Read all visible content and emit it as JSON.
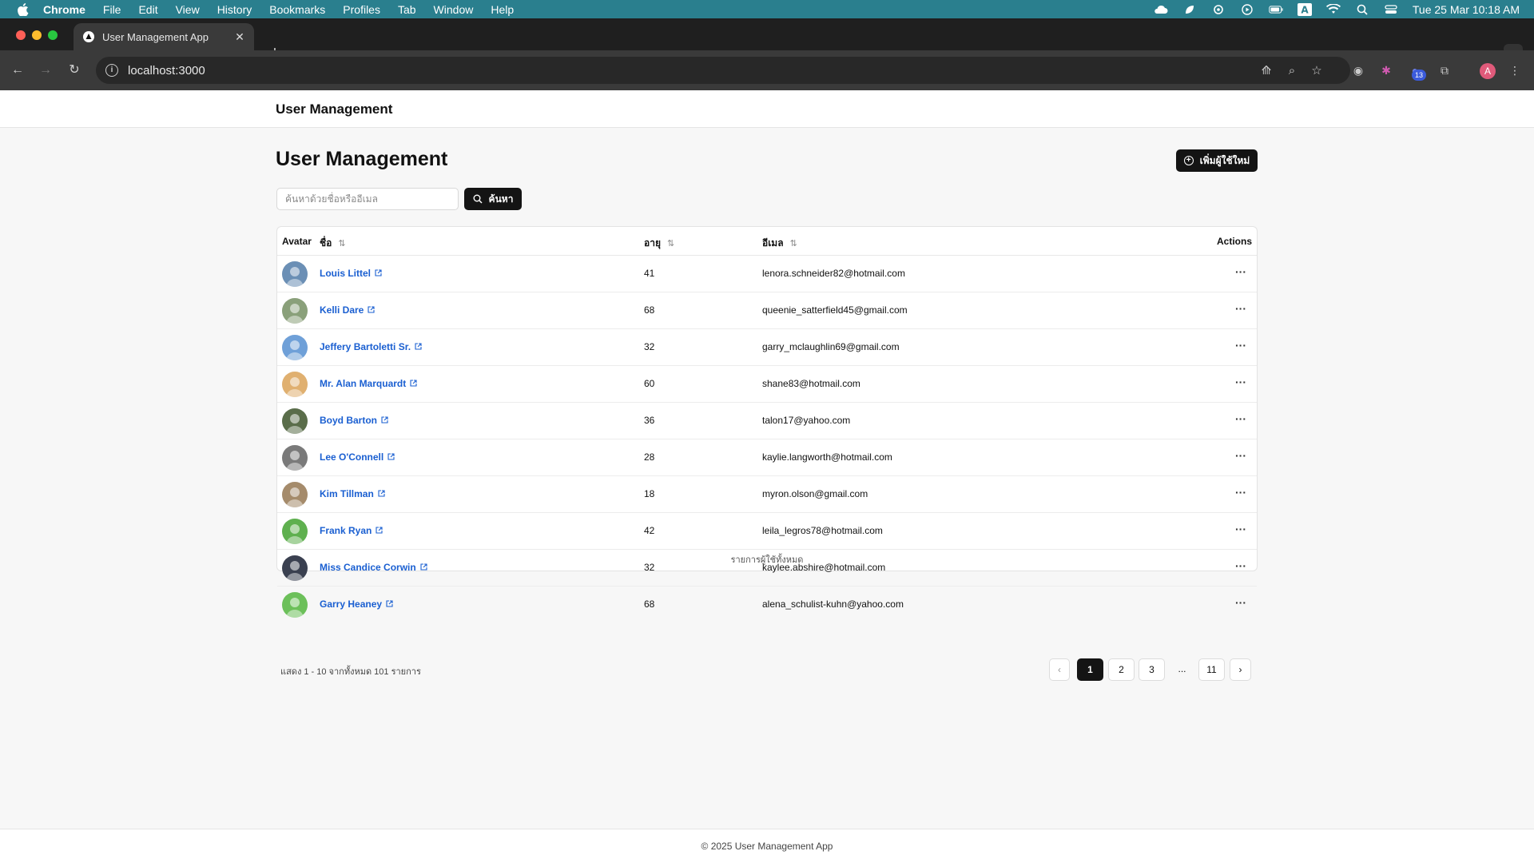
{
  "menubar": {
    "app": "Chrome",
    "items": [
      "File",
      "Edit",
      "View",
      "History",
      "Bookmarks",
      "Profiles",
      "Tab",
      "Window",
      "Help"
    ],
    "datetime": "Tue 25 Mar  10:18 AM"
  },
  "browser": {
    "tab_title": "User Management App",
    "url": "localhost:3000",
    "extension_badge": "13",
    "profile_initial": "A"
  },
  "app": {
    "brand": "User Management",
    "page_title": "User Management",
    "add_button": "เพิ่มผู้ใช้ใหม่",
    "search": {
      "placeholder": "ค้นหาด้วยชื่อหรืออีเมล",
      "value": "",
      "button": "ค้นหา"
    },
    "table": {
      "headers": {
        "avatar": "Avatar",
        "name": "ชื่อ",
        "age": "อายุ",
        "email": "อีเมล",
        "actions": "Actions"
      },
      "rows": [
        {
          "name": "Louis Littel",
          "age": "41",
          "email": "lenora.schneider82@hotmail.com",
          "avatar_color": "#6b8fb5"
        },
        {
          "name": "Kelli Dare",
          "age": "68",
          "email": "queenie_satterfield45@gmail.com",
          "avatar_color": "#8aa07a"
        },
        {
          "name": "Jeffery Bartoletti Sr.",
          "age": "32",
          "email": "garry_mclaughlin69@gmail.com",
          "avatar_color": "#6fa0d8"
        },
        {
          "name": "Mr. Alan Marquardt",
          "age": "60",
          "email": "shane83@hotmail.com",
          "avatar_color": "#e0b070"
        },
        {
          "name": "Boyd Barton",
          "age": "36",
          "email": "talon17@yahoo.com",
          "avatar_color": "#5a6d4a"
        },
        {
          "name": "Lee O'Connell",
          "age": "28",
          "email": "kaylie.langworth@hotmail.com",
          "avatar_color": "#7a7a7a"
        },
        {
          "name": "Kim Tillman",
          "age": "18",
          "email": "myron.olson@gmail.com",
          "avatar_color": "#a58b6b"
        },
        {
          "name": "Frank Ryan",
          "age": "42",
          "email": "leila_legros78@hotmail.com",
          "avatar_color": "#5fb04f"
        },
        {
          "name": "Miss Candice Corwin",
          "age": "32",
          "email": "kaylee.abshire@hotmail.com",
          "avatar_color": "#3a4050"
        },
        {
          "name": "Garry Heaney",
          "age": "68",
          "email": "alena_schulist-kuhn@yahoo.com",
          "avatar_color": "#6cc05a"
        }
      ],
      "caption": "รายการผู้ใช้ทั้งหมด"
    },
    "summary": "แสดง 1 - 10 จากทั้งหมด 101 รายการ",
    "pagination": {
      "pages": [
        "1",
        "2",
        "3",
        "...",
        "11"
      ],
      "current": "1"
    },
    "footer": "© 2025 User Management App"
  },
  "colors": {
    "accent": "#141414",
    "link": "#1a5fd1",
    "menubar": "#2a7f8e"
  }
}
